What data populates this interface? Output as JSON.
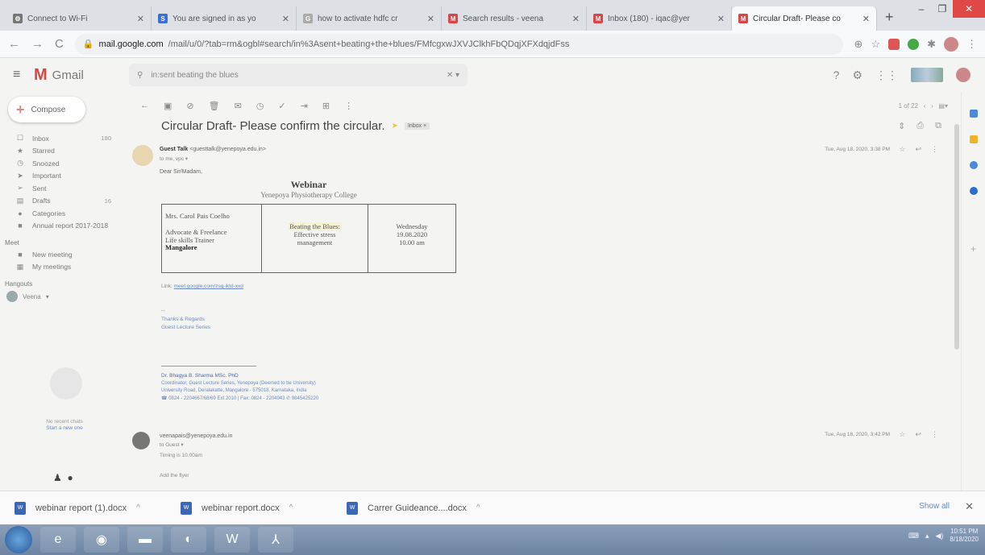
{
  "browser": {
    "tabs": [
      {
        "label": "Connect to Wi-Fi",
        "icon": "gear-icon",
        "color": "#777777"
      },
      {
        "label": "You are signed in as yo",
        "icon": "s-icon",
        "color": "#3b6fd6"
      },
      {
        "label": "how to activate hdfc cr",
        "icon": "google-icon",
        "color": "#aaaaaa"
      },
      {
        "label": "Search results - veena",
        "icon": "gmail-icon",
        "color": "#d44444"
      },
      {
        "label": "Inbox (180) - iqac@yer",
        "icon": "gmail-icon",
        "color": "#d44444"
      },
      {
        "label": "Circular Draft- Please co",
        "icon": "gmail-icon",
        "color": "#d44444",
        "active": true
      }
    ],
    "new_tab": "+",
    "window_controls": {
      "minimize": "–",
      "maximize": "❐",
      "close": "✕"
    },
    "url_domain": "mail.google.com",
    "url_path": "/mail/u/0/?tab=rm&ogbl#search/in%3Asent+beating+the+blues/FMfcgxwJXVJClkhFbQDqjXFXdqjdFss"
  },
  "gmail": {
    "app_name": "Gmail",
    "search_value": "in:sent beating the blues",
    "compose_label": "Compose",
    "nav": [
      {
        "label": "Inbox",
        "icon": "☐",
        "count": "180"
      },
      {
        "label": "Starred",
        "icon": "★",
        "count": ""
      },
      {
        "label": "Snoozed",
        "icon": "◷",
        "count": ""
      },
      {
        "label": "Important",
        "icon": "➤",
        "count": ""
      },
      {
        "label": "Sent",
        "icon": "➢",
        "count": ""
      },
      {
        "label": "Drafts",
        "icon": "▤",
        "count": "16"
      },
      {
        "label": "Categories",
        "icon": "●",
        "count": ""
      },
      {
        "label": "Annual report 2017-2018",
        "icon": "■",
        "count": ""
      }
    ],
    "meet_header": "Meet",
    "meet_items": [
      {
        "label": "New meeting",
        "icon": "■"
      },
      {
        "label": "My meetings",
        "icon": "▦"
      }
    ],
    "hangouts_header": "Hangouts",
    "hangout_user": "Veena",
    "no_chats": "No recent chats",
    "start_new": "Start a new one",
    "pager": "1 of 22"
  },
  "message": {
    "subject": "Circular Draft- Please confirm the circular.",
    "label": "Inbox ×",
    "first": {
      "sender_name": "Guest Talk",
      "sender_email": "<guesttalk@yenepoya.edu.in>",
      "to_line": "to me, vpc ▾",
      "date": "Tue, Aug 18, 2020, 3:38 PM",
      "greeting": "Dear Sir/Madam,",
      "webinar_title": "Webinar",
      "college": "Yenepoya Physiotherapy College",
      "speaker_name": "Mrs. Carol Pais Coelho",
      "speaker_role_1": "Advocate & Freelance",
      "speaker_role_2": "Life skills Trainer",
      "speaker_city": "Mangalore",
      "topic_1": "Beating the Blues:",
      "topic_2": "Effective stress",
      "topic_3": "management",
      "day": "Wednesday",
      "date_event": "19.08.2020",
      "time_event": "10.00 am",
      "link_label": "Link:",
      "link_url": "meet.google.com/zsq-iktd-xxd",
      "dash": "--",
      "regards_1": "Thanks & Regards",
      "regards_2": "Guest Lecture Series",
      "sig_name": "Dr. Bhagya B. Sharma MSc. PhD",
      "sig_role": "Coordinator, Guest Lecture Series, Yenepoya (Deemed to be University)",
      "sig_addr": "University Road, Deralakatte, Mangalore - 575018, Karnataka, India",
      "sig_phone": "☎ 0824 - 2204667/68/69 Ext 2010 | Fax: 0824 - 2204943 ✆ 9845425220"
    },
    "second": {
      "sender_email": "veenapais@yenepoya.edu.in",
      "to_line": "to Guest ▾",
      "date": "Tue, Aug 18, 2020, 3:42 PM",
      "line_1": "Timing is 10.00am",
      "line_2": "Add the flyer"
    }
  },
  "downloads": [
    {
      "name": "webinar report (1).docx"
    },
    {
      "name": "webinar report.docx"
    },
    {
      "name": "Carrer Guideance....docx"
    }
  ],
  "downloads_show_all": "Show all",
  "taskbar": {
    "time": "10:51 PM",
    "date": "8/18/2020"
  }
}
